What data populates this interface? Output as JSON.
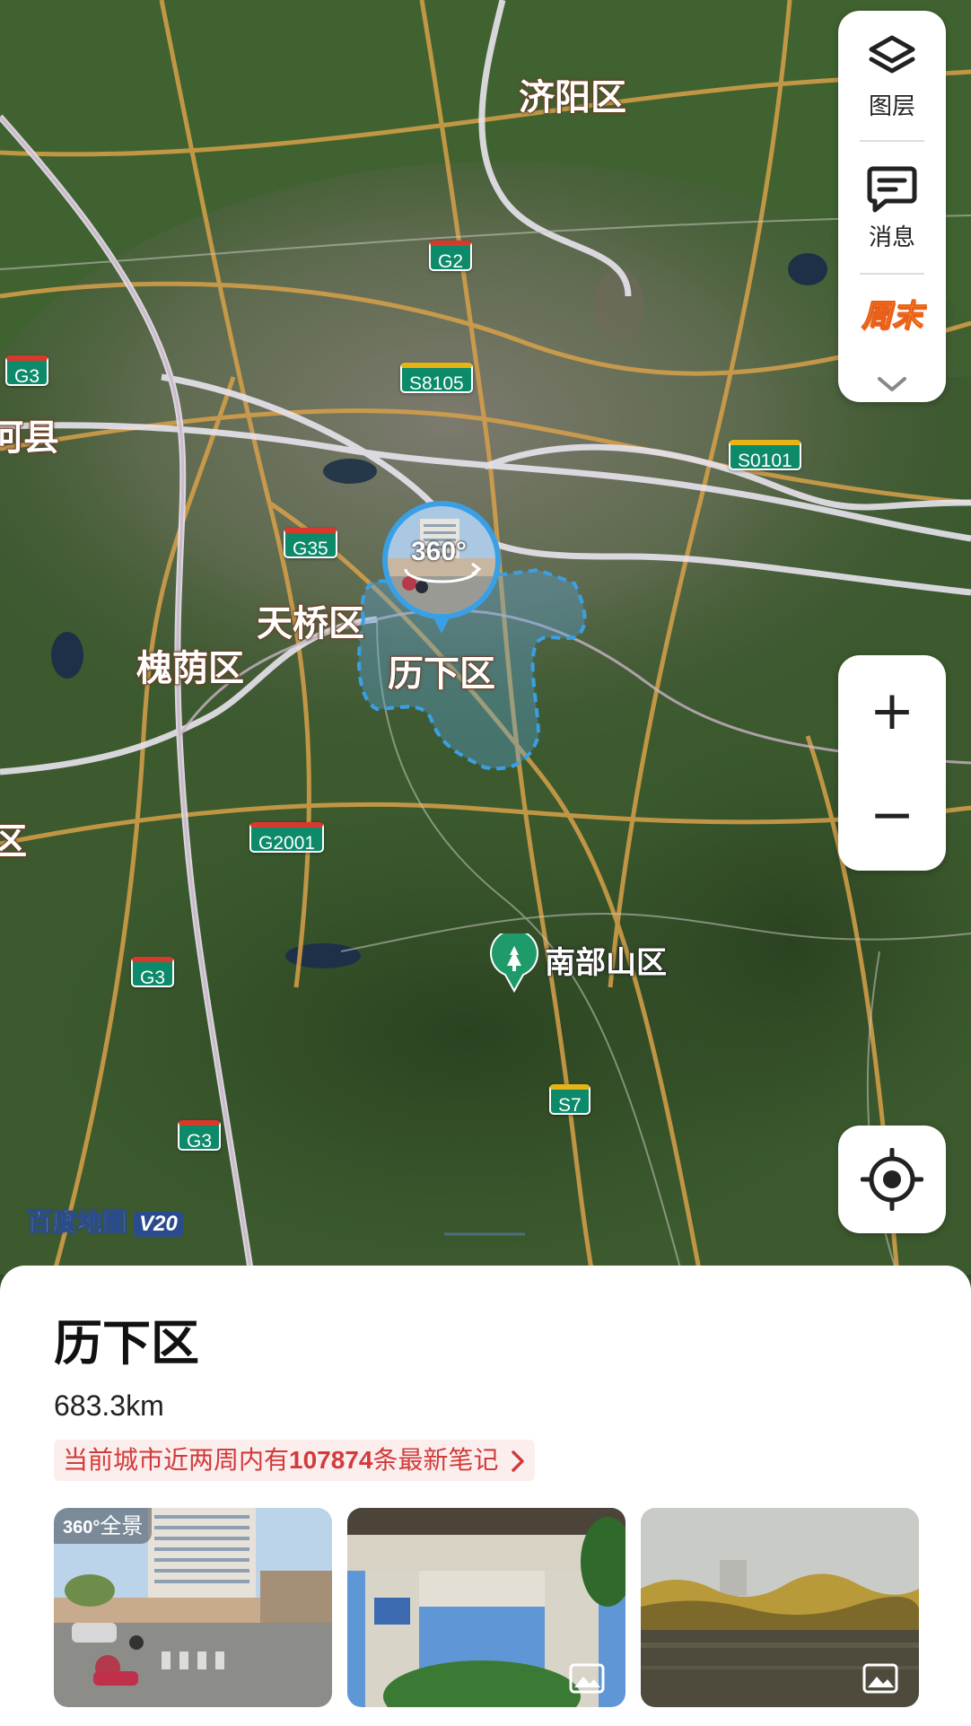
{
  "map": {
    "districts": {
      "jiyang": "济阳区",
      "tianqiao": "天桥区",
      "huaiyin": "槐荫区",
      "lixia": "历下区",
      "hexian_partial": "河县",
      "left_partial": "区"
    },
    "poi": {
      "nanbu": "南部山区"
    },
    "shields": {
      "g2": "G2",
      "g3_a": "G3",
      "g3_b": "G3",
      "g3_c": "G3",
      "s8105": "S8105",
      "s0101": "S0101",
      "g35": "G35",
      "g2001": "G2001",
      "s7": "S7"
    },
    "pano_badge": "360°",
    "watermark": "百度地图",
    "watermark_version": "V20"
  },
  "right_panel": {
    "layers_label": "图层",
    "messages_label": "消息",
    "weekend_label": "周末"
  },
  "zoom": {
    "plus": "+",
    "minus": "−"
  },
  "sheet": {
    "title": "历下区",
    "distance": "683.3km",
    "notes_prefix": "当前城市近两周内有",
    "notes_count": "107874",
    "notes_suffix": "条最新笔记",
    "thumb1_badge": "全景",
    "thumb1_badge_num": "360°"
  },
  "colors": {
    "road_orange": "#d8a14a",
    "highway_white": "#e8e4ee",
    "shield_green": "#0d8a6a",
    "district_blue": "#3aa0e6",
    "notes_red": "#d23b3b"
  }
}
